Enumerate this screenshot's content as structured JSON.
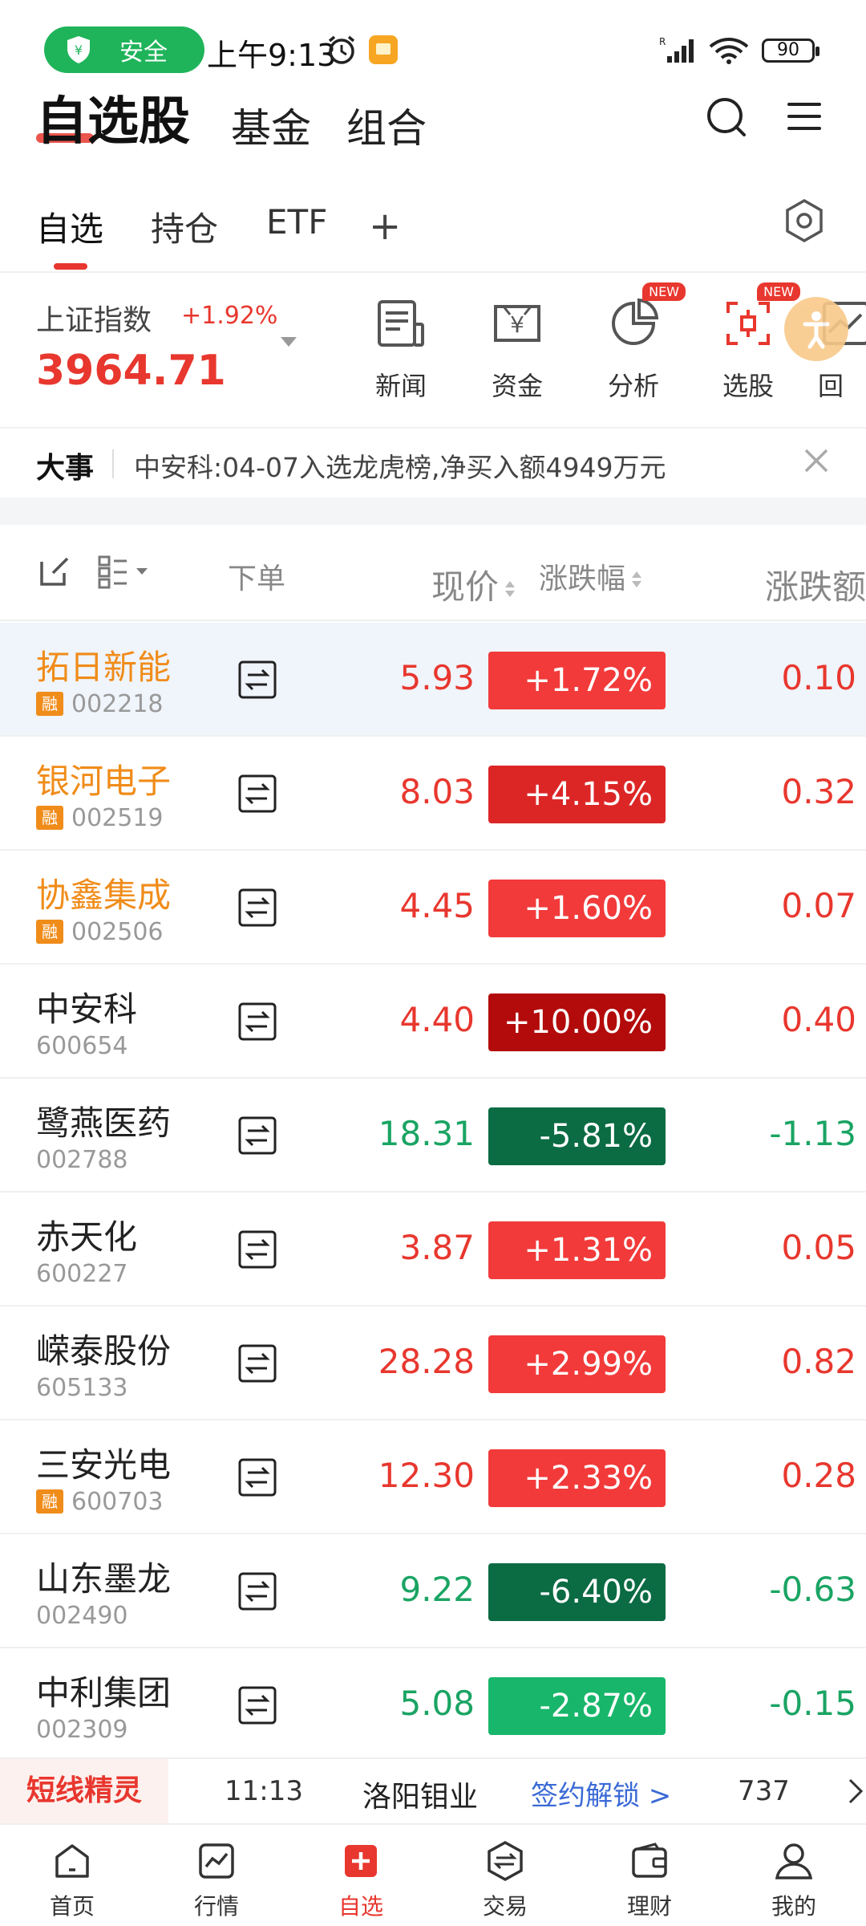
{
  "status_bar": {
    "safe_label": "安全",
    "time": "上午9:13",
    "battery": "90"
  },
  "header": {
    "main_tab": "自选股",
    "tabs": [
      "基金",
      "组合"
    ]
  },
  "subtabs": {
    "items": [
      "自选",
      "持仓",
      "ETF"
    ],
    "add": "+"
  },
  "index": {
    "name": "上证指数",
    "change": "+1.92%",
    "value": "3964.71"
  },
  "quick_actions": [
    {
      "label": "新闻",
      "icon": "news-icon",
      "badge": ""
    },
    {
      "label": "资金",
      "icon": "money-icon",
      "badge": ""
    },
    {
      "label": "分析",
      "icon": "pie-chart-icon",
      "badge": "NEW"
    },
    {
      "label": "选股",
      "icon": "stock-pick-icon",
      "badge": "NEW"
    },
    {
      "label": "回",
      "icon": "review-icon",
      "badge": ""
    }
  ],
  "news": {
    "tag": "大事",
    "text": "中安科:04-07入选龙虎榜,净买入额4949万元"
  },
  "table_header": {
    "order": "下单",
    "price": "现价",
    "change_pct": "涨跌幅",
    "change_amt": "涨跌额"
  },
  "stocks": [
    {
      "name": "拓日新能",
      "code": "002218",
      "rong": true,
      "highlight": true,
      "price": "5.93",
      "pct": "+1.72%",
      "amt": "0.10",
      "dir": "up",
      "box_color": "#f23a3a"
    },
    {
      "name": "银河电子",
      "code": "002519",
      "rong": true,
      "highlight": true,
      "price": "8.03",
      "pct": "+4.15%",
      "amt": "0.32",
      "dir": "up",
      "box_color": "#dc2626"
    },
    {
      "name": "协鑫集成",
      "code": "002506",
      "rong": true,
      "highlight": true,
      "price": "4.45",
      "pct": "+1.60%",
      "amt": "0.07",
      "dir": "up",
      "box_color": "#f23a3a"
    },
    {
      "name": "中安科",
      "code": "600654",
      "rong": false,
      "highlight": false,
      "price": "4.40",
      "pct": "+10.00%",
      "amt": "0.40",
      "dir": "up",
      "box_color": "#b30b0b"
    },
    {
      "name": "鹭燕医药",
      "code": "002788",
      "rong": false,
      "highlight": false,
      "price": "18.31",
      "pct": "-5.81%",
      "amt": "-1.13",
      "dir": "down",
      "box_color": "#0b6b43"
    },
    {
      "name": "赤天化",
      "code": "600227",
      "rong": false,
      "highlight": false,
      "price": "3.87",
      "pct": "+1.31%",
      "amt": "0.05",
      "dir": "up",
      "box_color": "#f23a3a"
    },
    {
      "name": "嵘泰股份",
      "code": "605133",
      "rong": false,
      "highlight": false,
      "price": "28.28",
      "pct": "+2.99%",
      "amt": "0.82",
      "dir": "up",
      "box_color": "#f23a3a"
    },
    {
      "name": "三安光电",
      "code": "600703",
      "rong": true,
      "highlight": false,
      "price": "12.30",
      "pct": "+2.33%",
      "amt": "0.28",
      "dir": "up",
      "box_color": "#f23a3a"
    },
    {
      "name": "山东墨龙",
      "code": "002490",
      "rong": false,
      "highlight": false,
      "price": "9.22",
      "pct": "-6.40%",
      "amt": "-0.63",
      "dir": "down",
      "box_color": "#0b6b43"
    },
    {
      "name": "中利集团",
      "code": "002309",
      "rong": false,
      "highlight": false,
      "price": "5.08",
      "pct": "-2.87%",
      "amt": "-0.15",
      "dir": "down",
      "box_color": "#18b66a"
    }
  ],
  "rong_label": "融",
  "ticker": {
    "brand": "短线精灵",
    "time": "11:13",
    "stock": "洛阳钼业",
    "link": "签约解锁 >",
    "num": "737"
  },
  "bottom_nav": [
    {
      "label": "首页",
      "icon": "home-icon"
    },
    {
      "label": "行情",
      "icon": "market-icon"
    },
    {
      "label": "自选",
      "icon": "watchlist-icon"
    },
    {
      "label": "交易",
      "icon": "trade-icon"
    },
    {
      "label": "理财",
      "icon": "wallet-icon"
    },
    {
      "label": "我的",
      "icon": "profile-icon"
    }
  ],
  "colors": {
    "up": "#e8372e",
    "down": "#1aa463",
    "highlight": "#f08c1a",
    "safe_green": "#1fb45a"
  }
}
